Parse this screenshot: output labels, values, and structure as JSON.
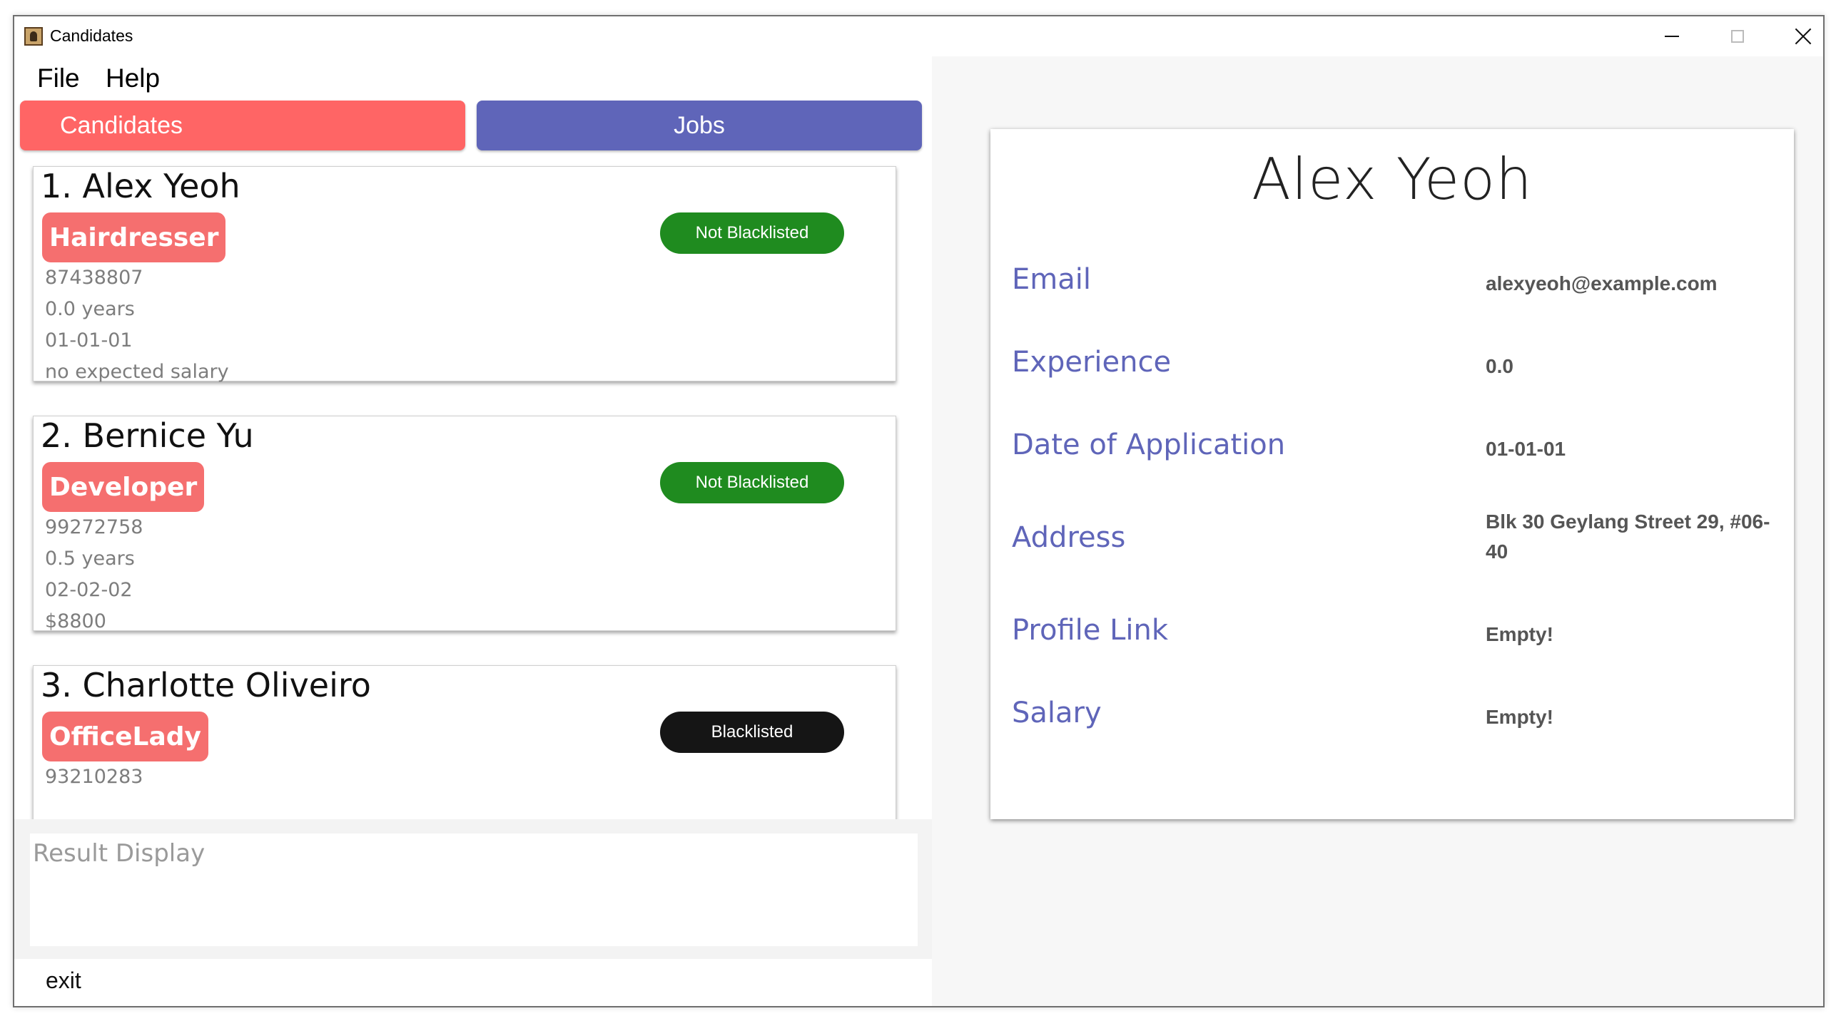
{
  "window": {
    "title": "Candidates"
  },
  "menu": {
    "file": "File",
    "help": "Help"
  },
  "tabs": {
    "candidates": "Candidates",
    "jobs": "Jobs"
  },
  "colors": {
    "candidates_tab": "#ff6565",
    "jobs_tab": "#5f65b9",
    "role_badge": "#f56f6f",
    "not_blacklisted": "#1f8b1f",
    "blacklisted": "#151515",
    "detail_label": "#5f65b9"
  },
  "candidates": [
    {
      "name": "1.  Alex Yeoh",
      "role": "Hairdresser",
      "status": "Not Blacklisted",
      "phone": "87438807",
      "experience": "0.0 years",
      "date": "01-01-01",
      "salary": "no expected salary"
    },
    {
      "name": "2.  Bernice Yu",
      "role": "Developer",
      "status": "Not Blacklisted",
      "phone": "99272758",
      "experience": "0.5 years",
      "date": "02-02-02",
      "salary": "$8800"
    },
    {
      "name": "3.  Charlotte Oliveiro",
      "role": "OfficeLady",
      "status": "Blacklisted",
      "phone": "93210283"
    }
  ],
  "result_display": {
    "placeholder": "Result Display"
  },
  "command": {
    "text": "exit"
  },
  "detail": {
    "name": "Alex Yeoh",
    "fields": [
      {
        "label": "Email",
        "value": "alexyeoh@example.com"
      },
      {
        "label": "Experience",
        "value": "0.0"
      },
      {
        "label": "Date of Application",
        "value": "01-01-01"
      },
      {
        "label": "Address",
        "value": "Blk 30 Geylang Street 29, #06-40"
      },
      {
        "label": "Profile Link",
        "value": "Empty!"
      },
      {
        "label": "Salary",
        "value": "Empty!"
      }
    ]
  }
}
